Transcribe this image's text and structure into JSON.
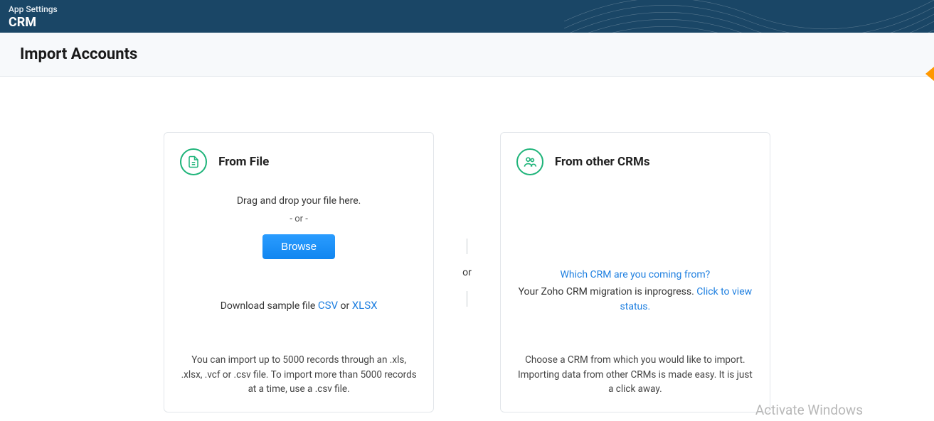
{
  "header": {
    "app_settings": "App Settings",
    "app_name": "CRM"
  },
  "page": {
    "title": "Import Accounts"
  },
  "separator_label": "or",
  "from_file": {
    "title": "From File",
    "drag_text": "Drag and drop your file here.",
    "or_text": "-  or  -",
    "browse_label": "Browse",
    "sample_prefix": "Download sample file ",
    "csv_label": "CSV",
    "sample_or": " or ",
    "xlsx_label": "XLSX",
    "footer": "You can import up to 5000 records through an .xls, .xlsx, .vcf or .csv file. To import more than 5000 records at a time, use a .csv file."
  },
  "from_other": {
    "title": "From other CRMs",
    "question": "Which CRM are you coming from?",
    "status_prefix": "Your Zoho CRM migration is inprogress. ",
    "status_link": "Click to view status.",
    "footer": "Choose a CRM from which you would like to import. Importing data from other CRMs is made easy. It is just a click away."
  },
  "watermark": "Activate Windows"
}
